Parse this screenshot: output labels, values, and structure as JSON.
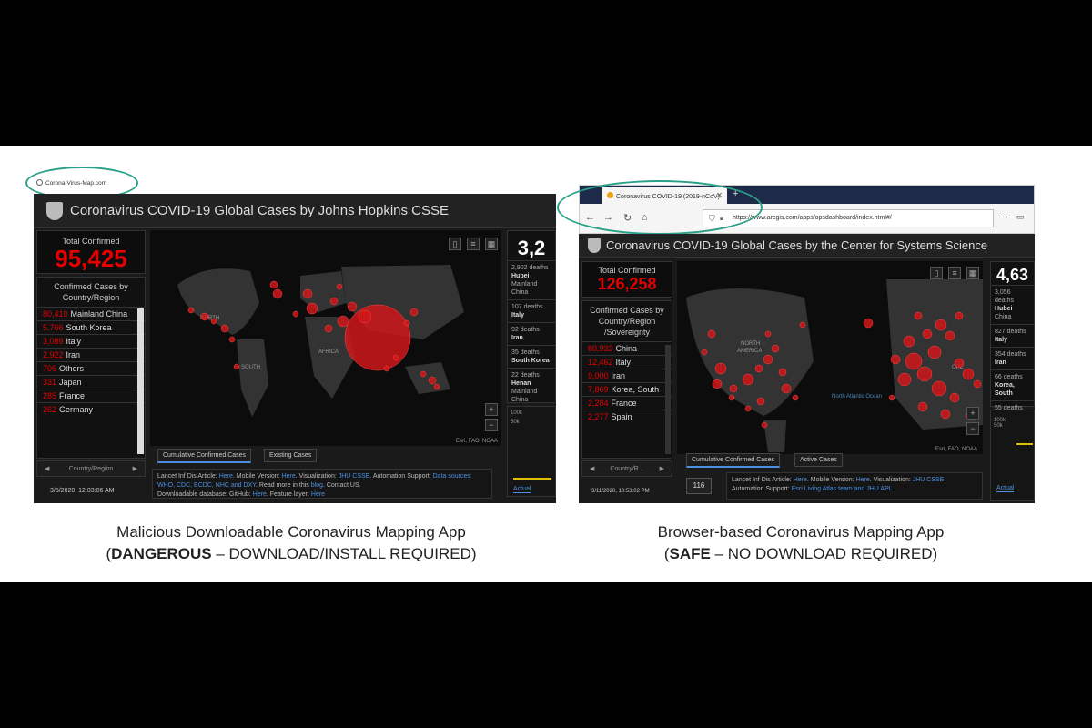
{
  "colors": {
    "accent_red": "#e60000",
    "oval": "#2aa089",
    "link": "#4a90e2"
  },
  "left": {
    "address": "Corona-Virus-Map.com",
    "title": "Coronavirus COVID-19 Global Cases by Johns Hopkins CSSE",
    "total_label": "Total Confirmed",
    "total_value": "95,425",
    "list_header": "Confirmed Cases by Country/Region",
    "rows": [
      {
        "num": "80,410",
        "label": "Mainland China"
      },
      {
        "num": "5,766",
        "label": "South Korea"
      },
      {
        "num": "3,089",
        "label": "Italy"
      },
      {
        "num": "2,922",
        "label": "Iran"
      },
      {
        "num": "706",
        "label": "Others"
      },
      {
        "num": "331",
        "label": "Japan"
      },
      {
        "num": "285",
        "label": "France"
      },
      {
        "num": "262",
        "label": "Germany"
      }
    ],
    "footer_nav": "Country/Region",
    "datetime": "3/5/2020, 12:03:06 AM",
    "tabs": [
      "Cumulative Confirmed Cases",
      "Existing Cases"
    ],
    "map_labels": [
      "NORTH",
      "SOUTH",
      "AFRICA"
    ],
    "attribution": "Esri, FAO, NOAA",
    "info_1": "Lancet Inf Dis Article: ",
    "info_2": "Here",
    "info_3": ". Mobile Version: ",
    "info_4": "Here",
    "info_5": ". Visualization: ",
    "info_6": "JHU CSSE",
    "info_7": ". Automation Support: ",
    "info_8": "Data sources: WHO, CDC, ECDC, NHC and DXY",
    "info_9": ". Read more in this ",
    "info_10": "blog",
    "info_11": ". Contact US.",
    "info_12": "Downloadable database: GitHub: ",
    "info_13": "Here",
    "info_14": ". Feature layer: ",
    "info_15": "Here",
    "deaths_big": "3,2",
    "deaths": [
      {
        "n": "2,902",
        "t1": "deaths",
        "t2": "Hubei",
        "t3": "Mainland China"
      },
      {
        "n": "107",
        "t1": "deaths",
        "t2": "Italy",
        "t3": ""
      },
      {
        "n": "92",
        "t1": "deaths",
        "t2": "Iran",
        "t3": ""
      },
      {
        "n": "35",
        "t1": "deaths",
        "t2": "South Korea",
        "t3": ""
      },
      {
        "n": "22",
        "t1": "deaths",
        "t2": "Henan",
        "t3": "Mainland China"
      }
    ],
    "actual_tab": "Actual",
    "y_100k": "100k",
    "y_50k": "50k"
  },
  "right": {
    "browser_tab": "Coronavirus COVID-19 (2019-nCoV)",
    "url": "https://www.arcgis.com/apps/opsdashboard/index.html#/",
    "title": "Coronavirus COVID-19 Global Cases by the Center for Systems Science",
    "total_label": "Total Confirmed",
    "total_value": "126,258",
    "list_header": "Confirmed Cases by Country/Region /Sovereignty",
    "rows": [
      {
        "num": "80,932",
        "label": "China"
      },
      {
        "num": "12,462",
        "label": "Italy"
      },
      {
        "num": "9,000",
        "label": "Iran"
      },
      {
        "num": "7,869",
        "label": "Korea, South"
      },
      {
        "num": "2,284",
        "label": "France"
      },
      {
        "num": "2,277",
        "label": "Spain"
      }
    ],
    "footer_nav": "Country/R...",
    "datetime": "3/11/2020, 10:53:02 PM",
    "count_badge": "116",
    "tabs": [
      "Cumulative Confirmed Cases",
      "Active Cases"
    ],
    "map_labels": [
      "NORTH",
      "AMERICA",
      "North Atlantic Ocean",
      "OPE"
    ],
    "attribution": "Esri, FAO, NOAA",
    "info_1": "Lancet Inf Dis Article: ",
    "info_2": "Here",
    "info_3": ". Mobile Version: ",
    "info_4": "Here",
    "info_5": ". Visualization: ",
    "info_6": "JHU CSSE",
    "info_7": ". Automation Support: ",
    "info_8": "Esri Living Atlas team and JHU APL",
    "deaths_big": "4,63",
    "deaths": [
      {
        "n": "3,056",
        "t1": "deaths",
        "t2": "Hubei",
        "t3": "China"
      },
      {
        "n": "827",
        "t1": "deaths",
        "t2": "Italy",
        "t3": ""
      },
      {
        "n": "354",
        "t1": "deaths",
        "t2": "Iran",
        "t3": ""
      },
      {
        "n": "66",
        "t1": "deaths",
        "t2": "Korea, South",
        "t3": ""
      },
      {
        "n": "55",
        "t1": "deaths",
        "t2": "",
        "t3": ""
      }
    ],
    "actual_tab": "Actual",
    "y_100k": "100k",
    "y_50k": "50k"
  },
  "captions": {
    "left_line1": "Malicious Downloadable Coronavirus Mapping App",
    "left_paren_open": "(",
    "left_strong": "DANGEROUS",
    "left_rest": " – DOWNLOAD/INSTALL REQUIRED)",
    "right_line1": "Browser-based Coronavirus Mapping App",
    "right_paren_open": "(",
    "right_strong": "SAFE",
    "right_rest": " – NO DOWNLOAD REQUIRED)"
  }
}
